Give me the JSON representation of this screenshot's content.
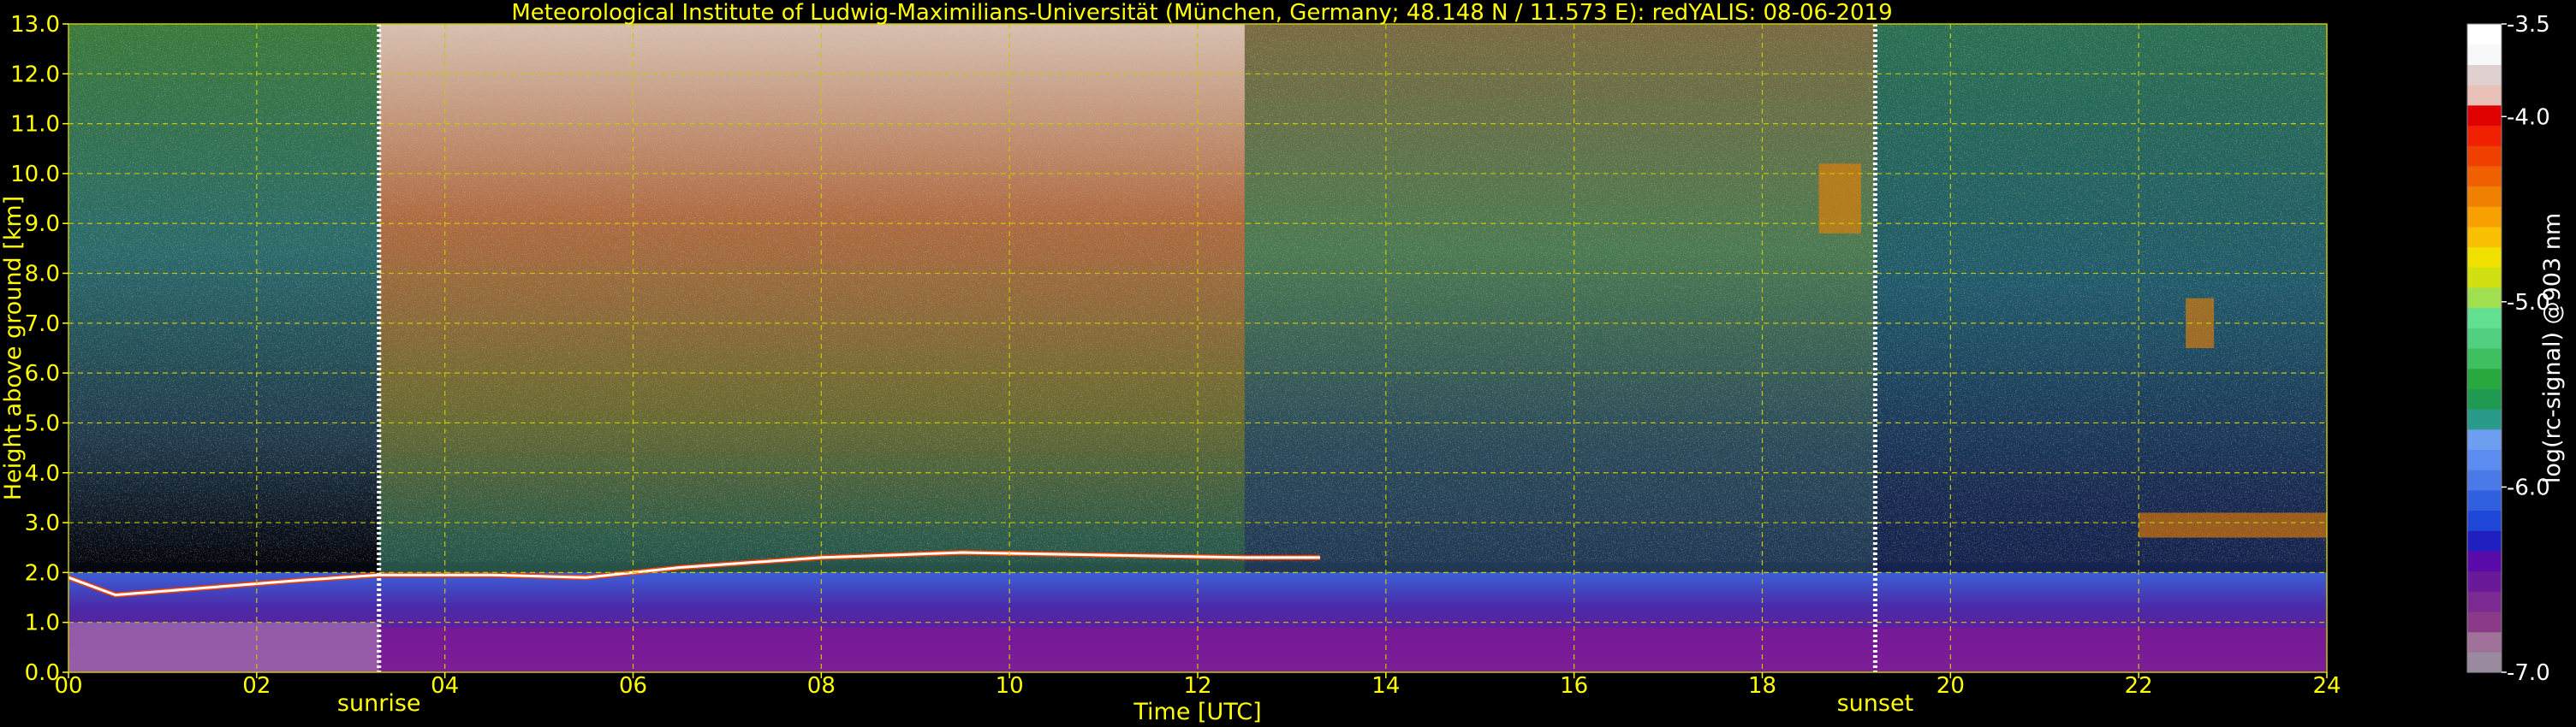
{
  "chart_data": {
    "type": "heatmap",
    "title": "Meteorological Institute of Ludwig-Maximilians-Universität (München, Germany; 48.148 N / 11.573 E):    redYALIS: 08-06-2019",
    "xlabel": "Time [UTC]",
    "ylabel": "Height above ground [km]",
    "xlim": [
      0,
      24
    ],
    "ylim": [
      0,
      13
    ],
    "x_ticks": [
      0,
      2,
      4,
      6,
      8,
      10,
      12,
      14,
      16,
      18,
      20,
      22,
      24
    ],
    "x_tick_labels": [
      "00",
      "02",
      "04",
      "06",
      "08",
      "10",
      "12",
      "14",
      "16",
      "18",
      "20",
      "22",
      "24"
    ],
    "y_ticks": [
      0,
      1,
      2,
      3,
      4,
      5,
      6,
      7,
      8,
      9,
      10,
      11,
      12,
      13
    ],
    "y_tick_labels": [
      "0.0",
      "1.0",
      "2.0",
      "3.0",
      "4.0",
      "5.0",
      "6.0",
      "7.0",
      "8.0",
      "9.0",
      "10.0",
      "11.0",
      "12.0",
      "13.0"
    ],
    "grid": true,
    "grid_color": "#c8c800",
    "text_color": "#ffff00",
    "background": "#000000",
    "annotations": [
      {
        "label": "sunrise",
        "x": 3.3
      },
      {
        "label": "sunset",
        "x": 19.2
      }
    ],
    "boundary_layer_top_km": [
      {
        "x": 0.0,
        "y": 1.9
      },
      {
        "x": 0.5,
        "y": 1.55
      },
      {
        "x": 1.5,
        "y": 1.7
      },
      {
        "x": 2.5,
        "y": 1.85
      },
      {
        "x": 3.3,
        "y": 1.95
      },
      {
        "x": 4.5,
        "y": 1.95
      },
      {
        "x": 5.5,
        "y": 1.9
      },
      {
        "x": 6.5,
        "y": 2.1
      },
      {
        "x": 8.0,
        "y": 2.3
      },
      {
        "x": 9.5,
        "y": 2.4
      },
      {
        "x": 11.0,
        "y": 2.35
      },
      {
        "x": 12.5,
        "y": 2.3
      },
      {
        "x": 13.3,
        "y": 2.3
      }
    ],
    "cloud_features": [
      {
        "x0": 18.6,
        "x1": 19.05,
        "y0": 8.8,
        "y1": 10.2
      },
      {
        "x0": 22.5,
        "x1": 22.8,
        "y0": 6.5,
        "y1": 7.5
      },
      {
        "x0": 22.0,
        "x1": 24.0,
        "y0": 2.7,
        "y1": 3.2
      }
    ],
    "colorbar": {
      "label": "log(rc-signal) @903 nm",
      "min": -7.0,
      "max": -3.5,
      "ticks": [
        -3.5,
        -4.0,
        -5.0,
        -6.0,
        -7.0
      ],
      "tick_labels": [
        "-3.5",
        "-4.0",
        "-5.0",
        "-6.0",
        "-7.0"
      ],
      "colors_bottom_to_top": [
        "#9a8aa0",
        "#a0729a",
        "#8a3a88",
        "#7a2a90",
        "#6a1a98",
        "#5a0aa8",
        "#2020c0",
        "#2048d8",
        "#3060e0",
        "#4a7ae8",
        "#5c8cf0",
        "#6e9ef0",
        "#2a9a8a",
        "#1f9a50",
        "#2aa840",
        "#3ec060",
        "#50d080",
        "#60e090",
        "#a0e050",
        "#d0e010",
        "#f0e000",
        "#f8c000",
        "#f8a000",
        "#f08000",
        "#f06000",
        "#f04000",
        "#f02000",
        "#e00000",
        "#e8c0b8",
        "#e0d0d0",
        "#f8f8f8",
        "#ffffff"
      ]
    }
  }
}
